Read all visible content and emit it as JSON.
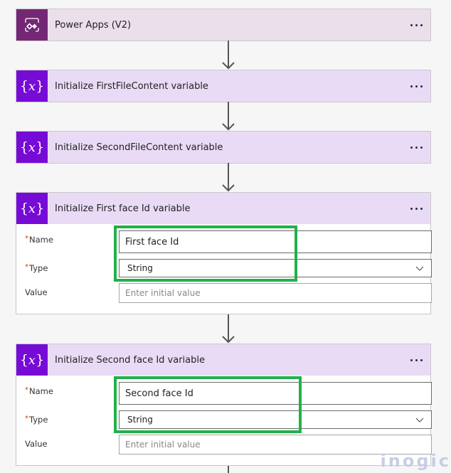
{
  "flow": {
    "steps": [
      {
        "title": "Power Apps (V2)",
        "icon": "power-apps-icon",
        "more_label": "More options"
      },
      {
        "title": "Initialize FirstFileContent variable",
        "icon": "variable-icon",
        "more_label": "More options"
      },
      {
        "title": "Initialize SecondFileContent variable",
        "icon": "variable-icon",
        "more_label": "More options"
      },
      {
        "title": "Initialize First face Id variable",
        "icon": "variable-icon",
        "more_label": "More options",
        "fields": {
          "name_label": "Name",
          "name_value": "First face Id",
          "type_label": "Type",
          "type_value": "String",
          "value_label": "Value",
          "value_placeholder": "Enter initial value",
          "required_mark": "*"
        }
      },
      {
        "title": "Initialize Second face Id variable",
        "icon": "variable-icon",
        "more_label": "More options",
        "fields": {
          "name_label": "Name",
          "name_value": "Second face Id",
          "type_label": "Type",
          "type_value": "String",
          "value_label": "Value",
          "value_placeholder": "Enter initial value",
          "required_mark": "*"
        }
      }
    ]
  },
  "colors": {
    "power_apps_brand": "#742774",
    "variable_brand": "#770bd6",
    "highlight": "#22b04b",
    "required": "#d83b01"
  },
  "watermark": "inogic"
}
